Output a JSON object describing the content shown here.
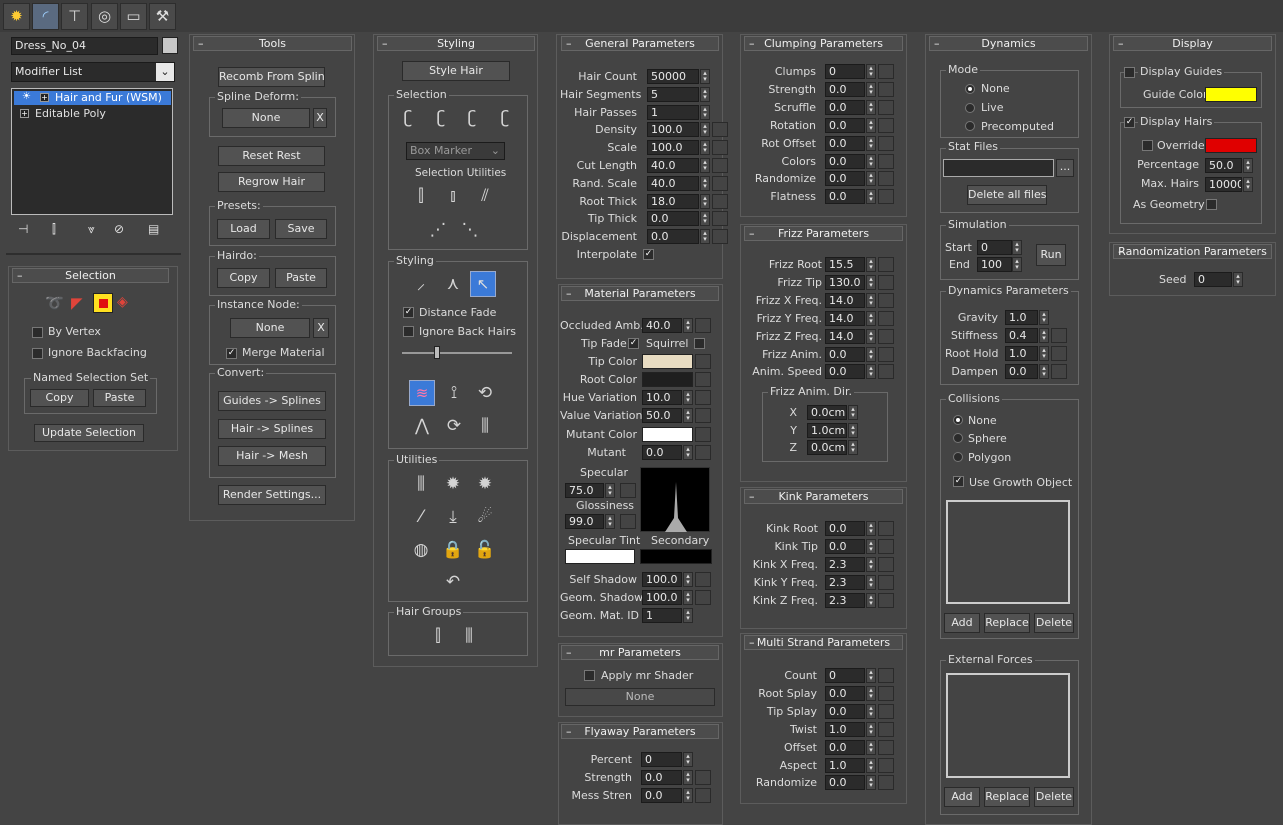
{
  "tabs": [
    "create",
    "modify",
    "hierarchy",
    "motion",
    "display",
    "utilities"
  ],
  "object_name": "Dress_No_04",
  "modifier_list": "Modifier List",
  "stack": [
    "Hair and Fur (WSM)",
    "Editable Poly"
  ],
  "selection": {
    "title": "Selection",
    "by_vertex": "By Vertex",
    "ignore_backfacing": "Ignore Backfacing",
    "named_set": "Named Selection Set",
    "copy": "Copy",
    "paste": "Paste",
    "update": "Update Selection"
  },
  "tools": {
    "title": "Tools",
    "recomb": "Recomb From Splines",
    "spline_deform": "Spline Deform:",
    "none1": "None",
    "x": "X",
    "reset_rest": "Reset Rest",
    "regrow": "Regrow Hair",
    "presets": "Presets:",
    "load": "Load",
    "save": "Save",
    "hairdo": "Hairdo:",
    "copy": "Copy",
    "paste": "Paste",
    "instance_node": "Instance Node:",
    "none2": "None",
    "merge_material": "Merge Material",
    "convert": "Convert:",
    "guides_splines": "Guides -> Splines",
    "hair_splines": "Hair -> Splines",
    "hair_mesh": "Hair -> Mesh",
    "render_settings": "Render Settings..."
  },
  "styling": {
    "title": "Styling",
    "style_hair": "Style Hair",
    "selection": "Selection",
    "box_marker": "Box Marker",
    "sel_utilities": "Selection Utilities",
    "styling": "Styling",
    "distance_fade": "Distance Fade",
    "ignore_back": "Ignore Back Hairs",
    "utilities": "Utilities",
    "hair_groups": "Hair Groups"
  },
  "general": {
    "title": "General Parameters",
    "rows": [
      {
        "label": "Hair Count",
        "value": "50000"
      },
      {
        "label": "Hair Segments",
        "value": "5"
      },
      {
        "label": "Hair Passes",
        "value": "1"
      },
      {
        "label": "Density",
        "value": "100.0"
      },
      {
        "label": "Scale",
        "value": "100.0"
      },
      {
        "label": "Cut Length",
        "value": "40.0"
      },
      {
        "label": "Rand. Scale",
        "value": "40.0"
      },
      {
        "label": "Root Thick",
        "value": "18.0"
      },
      {
        "label": "Tip Thick",
        "value": "0.0"
      },
      {
        "label": "Displacement",
        "value": "0.0"
      }
    ],
    "interpolate": "Interpolate"
  },
  "material": {
    "title": "Material Parameters",
    "occluded": "Occluded Amb.",
    "occluded_val": "40.0",
    "tip_fade": "Tip Fade",
    "squirrel": "Squirrel",
    "tip_color": "Tip Color",
    "root_color": "Root Color",
    "hue_var": "Hue Variation",
    "hue_val": "10.0",
    "value_var": "Value Variation",
    "value_val": "50.0",
    "mutant_color": "Mutant Color",
    "mutant": "Mutant",
    "mutant_val": "0.0",
    "specular": "Specular",
    "specular_val": "75.0",
    "glossiness": "Glossiness",
    "glossiness_val": "99.0",
    "spec_tint": "Specular Tint",
    "secondary": "Secondary",
    "self_shadow": "Self Shadow",
    "self_shadow_val": "100.0",
    "geom_shadow": "Geom. Shadow",
    "geom_shadow_val": "100.0",
    "geom_mat": "Geom. Mat. ID",
    "geom_mat_val": "1"
  },
  "mr": {
    "title": "mr Parameters",
    "apply": "Apply mr Shader",
    "none": "None"
  },
  "flyaway": {
    "title": "Flyaway Parameters",
    "rows": [
      {
        "label": "Percent",
        "value": "0"
      },
      {
        "label": "Strength",
        "value": "0.0"
      },
      {
        "label": "Mess Stren",
        "value": "0.0"
      }
    ]
  },
  "clumping": {
    "title": "Clumping Parameters",
    "rows": [
      {
        "label": "Clumps",
        "value": "0"
      },
      {
        "label": "Strength",
        "value": "0.0"
      },
      {
        "label": "Scruffle",
        "value": "0.0"
      },
      {
        "label": "Rotation",
        "value": "0.0"
      },
      {
        "label": "Rot Offset",
        "value": "0.0"
      },
      {
        "label": "Colors",
        "value": "0.0"
      },
      {
        "label": "Randomize",
        "value": "0.0"
      },
      {
        "label": "Flatness",
        "value": "0.0"
      }
    ]
  },
  "frizz": {
    "title": "Frizz Parameters",
    "rows": [
      {
        "label": "Frizz Root",
        "value": "15.5"
      },
      {
        "label": "Frizz Tip",
        "value": "130.0"
      },
      {
        "label": "Frizz X Freq.",
        "value": "14.0"
      },
      {
        "label": "Frizz Y Freq.",
        "value": "14.0"
      },
      {
        "label": "Frizz Z Freq.",
        "value": "14.0"
      },
      {
        "label": "Frizz Anim.",
        "value": "0.0"
      },
      {
        "label": "Anim. Speed",
        "value": "0.0"
      }
    ],
    "dir_title": "Frizz Anim. Dir.",
    "dir": [
      {
        "label": "X",
        "value": "0.0cm"
      },
      {
        "label": "Y",
        "value": "1.0cm"
      },
      {
        "label": "Z",
        "value": "0.0cm"
      }
    ]
  },
  "kink": {
    "title": "Kink Parameters",
    "rows": [
      {
        "label": "Kink Root",
        "value": "0.0"
      },
      {
        "label": "Kink Tip",
        "value": "0.0"
      },
      {
        "label": "Kink X Freq.",
        "value": "2.3"
      },
      {
        "label": "Kink Y Freq.",
        "value": "2.3"
      },
      {
        "label": "Kink Z Freq.",
        "value": "2.3"
      }
    ]
  },
  "multistrand": {
    "title": "Multi Strand Parameters",
    "rows": [
      {
        "label": "Count",
        "value": "0"
      },
      {
        "label": "Root Splay",
        "value": "0.0"
      },
      {
        "label": "Tip Splay",
        "value": "0.0"
      },
      {
        "label": "Twist",
        "value": "1.0"
      },
      {
        "label": "Offset",
        "value": "0.0"
      },
      {
        "label": "Aspect",
        "value": "1.0"
      },
      {
        "label": "Randomize",
        "value": "0.0"
      }
    ]
  },
  "dynamics": {
    "title": "Dynamics",
    "mode": "Mode",
    "none": "None",
    "live": "Live",
    "precomputed": "Precomputed",
    "stat_files": "Stat Files",
    "dots": "...",
    "delete_all": "Delete all files",
    "simulation": "Simulation",
    "start": "Start",
    "start_val": "0",
    "end": "End",
    "end_val": "100",
    "run": "Run",
    "dyn_params": "Dynamics Parameters",
    "params": [
      {
        "label": "Gravity",
        "value": "1.0"
      },
      {
        "label": "Stiffness",
        "value": "0.4"
      },
      {
        "label": "Root Hold",
        "value": "1.0"
      },
      {
        "label": "Dampen",
        "value": "0.0"
      }
    ],
    "collisions": "Collisions",
    "c_none": "None",
    "sphere": "Sphere",
    "polygon": "Polygon",
    "use_growth": "Use Growth Object",
    "add": "Add",
    "replace": "Replace",
    "delete": "Delete",
    "external": "External Forces"
  },
  "display": {
    "title": "Display",
    "display_guides": "Display Guides",
    "guide_color": "Guide Color",
    "display_hairs": "Display Hairs",
    "override": "Override:",
    "percentage": "Percentage",
    "percentage_val": "50.0",
    "max_hairs": "Max. Hairs",
    "max_hairs_val": "10000",
    "as_geometry": "As Geometry"
  },
  "random": {
    "title": "Randomization Parameters",
    "seed": "Seed",
    "seed_val": "0"
  },
  "colors": {
    "guide": "#ffff00",
    "override": "#e00000",
    "tip": "#e8dcc2",
    "root": "#1f1f1f",
    "mutant": "#ffffff",
    "spec_tint": "#ffffff",
    "secondary": "#000000",
    "selected": "#3b7ad8"
  }
}
